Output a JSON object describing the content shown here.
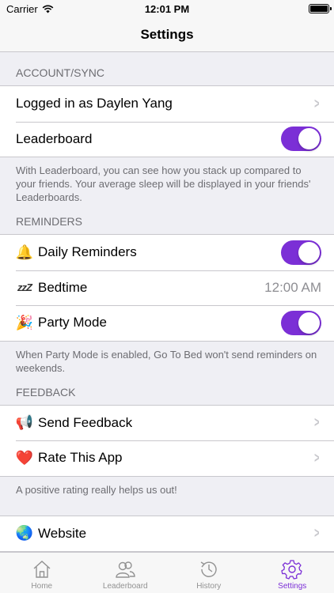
{
  "status": {
    "carrier": "Carrier",
    "time": "12:01 PM"
  },
  "nav": {
    "title": "Settings"
  },
  "sections": {
    "account": {
      "header": "ACCOUNT/SYNC",
      "logged_in": "Logged in as Daylen Yang",
      "leaderboard": "Leaderboard",
      "leaderboard_on": true,
      "footer": "With Leaderboard, you can see how you stack up compared to your friends. Your average sleep will be displayed in your friends' Leaderboards."
    },
    "reminders": {
      "header": "REMINDERS",
      "daily": "Daily Reminders",
      "bedtime": "Bedtime",
      "bedtime_value": "12:00 AM",
      "party": "Party Mode",
      "footer": "When Party Mode is enabled, Go To Bed won't send reminders on weekends."
    },
    "feedback": {
      "header": "FEEDBACK",
      "send": "Send Feedback",
      "rate": "Rate This App",
      "footer": "A positive rating really helps us out!"
    },
    "more": {
      "website": "Website"
    }
  },
  "tabs": {
    "home": "Home",
    "leaderboard": "Leaderboard",
    "history": "History",
    "settings": "Settings"
  },
  "colors": {
    "accent": "#7b2fd6",
    "background": "#efeff4"
  },
  "icons": {
    "bell": "🔔",
    "zzz": "zzZ",
    "party": "🎉",
    "megaphone": "📢",
    "heart": "❤️",
    "globe": "🌏"
  }
}
